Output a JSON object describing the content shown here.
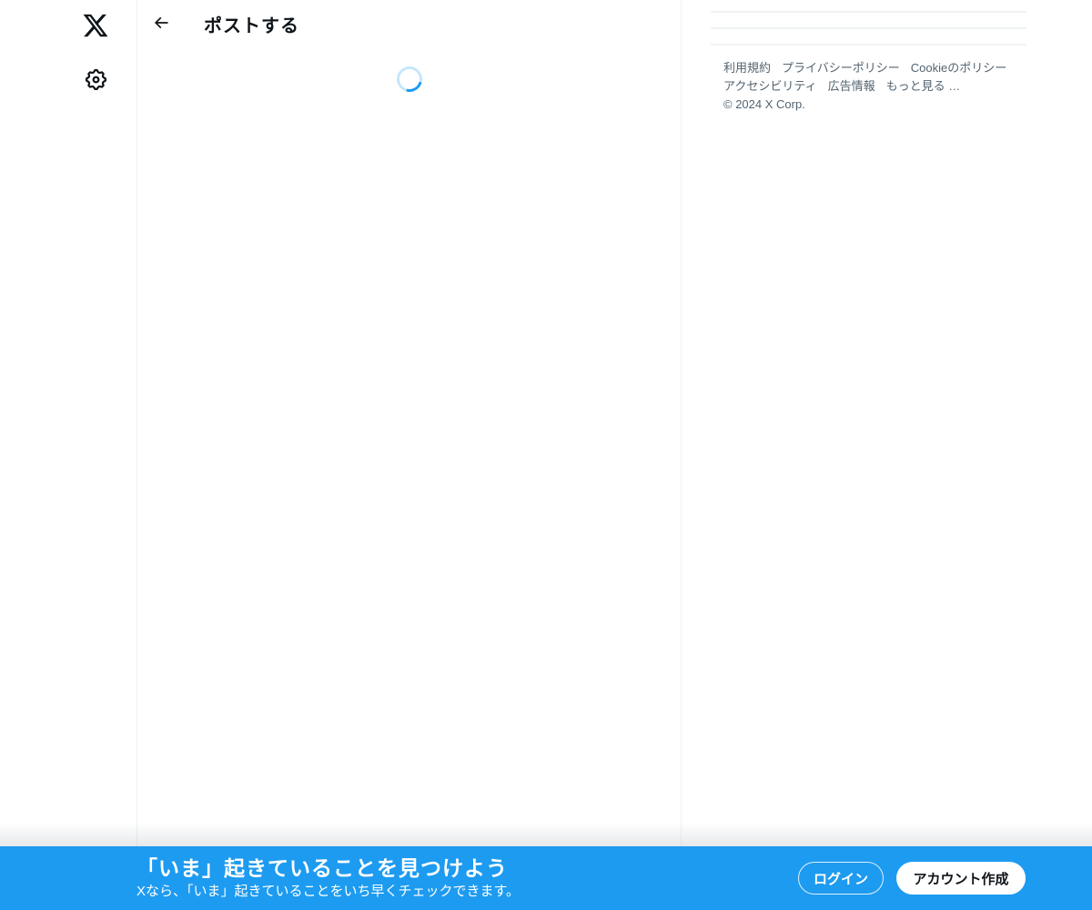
{
  "colors": {
    "accent_blue": "#1d9bf0",
    "text_primary": "#0f1419",
    "text_secondary": "#536471",
    "divider": "#eff3f4",
    "banner_background": "#1d9bf0"
  },
  "icons": {
    "logo": "x-logo",
    "settings": "gear-icon",
    "back": "arrow-left-icon",
    "loading": "spinner"
  },
  "header": {
    "title": "ポストする"
  },
  "main": {
    "state": "loading"
  },
  "sidebar": {
    "footer": {
      "links": [
        "利用規約",
        "プライバシーポリシー",
        "Cookieのポリシー",
        "アクセシビリティ",
        "広告情報",
        "もっと見る …"
      ],
      "copyright": "© 2024 X Corp."
    }
  },
  "banner": {
    "title": "「いま」起きていることを見つけよう",
    "subtitle": "Xなら、「いま」起きていることをいち早くチェックできます。",
    "login_label": "ログイン",
    "signup_label": "アカウント作成"
  }
}
